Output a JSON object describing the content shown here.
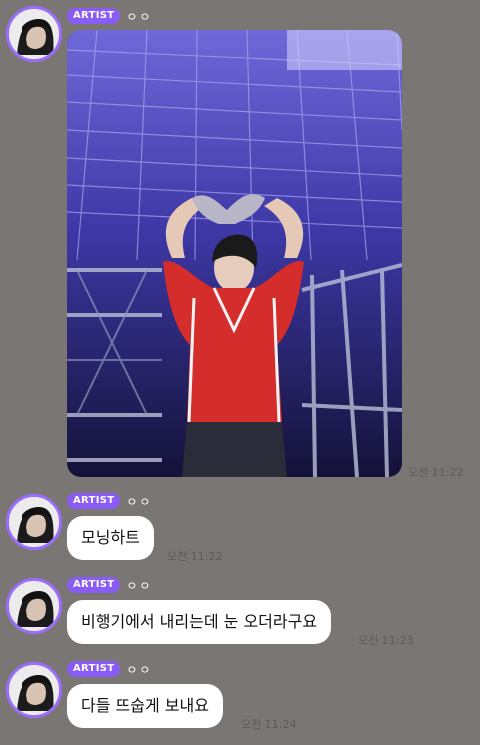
{
  "messages": [
    {
      "badge": "ARTIST",
      "sender": "ㅇㅇ",
      "type": "image",
      "time": "오전 11:22"
    },
    {
      "badge": "ARTIST",
      "sender": "ㅇㅇ",
      "type": "text",
      "text": "모닝하트",
      "time": "오전 11:22"
    },
    {
      "badge": "ARTIST",
      "sender": "ㅇㅇ",
      "type": "text",
      "text": "비행기에서 내리는데 눈 오더라구요",
      "time": "오전 11:23"
    },
    {
      "badge": "ARTIST",
      "sender": "ㅇㅇ",
      "type": "text",
      "text": "다들 뜨숩게 보내요",
      "time": "오전 11:24"
    }
  ],
  "colors": {
    "background": "#7a7673",
    "badge": "#8a5cf6",
    "avatar_ring": "#9b6dff",
    "bubble": "#ffffff"
  },
  "icons": {
    "avatar": "avatar-image",
    "photo": "stage-photo"
  }
}
